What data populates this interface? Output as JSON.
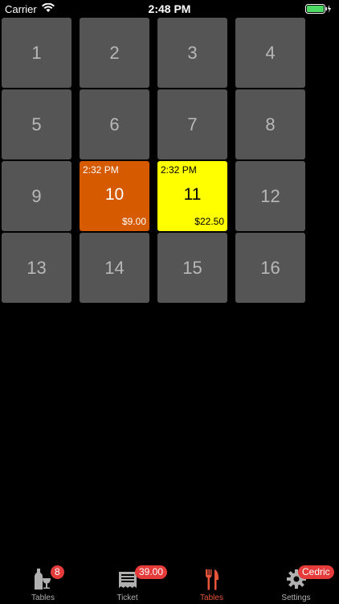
{
  "status_bar": {
    "carrier": "Carrier",
    "time": "2:48 PM"
  },
  "tables": [
    {
      "number": "1"
    },
    {
      "number": "2"
    },
    {
      "number": "3"
    },
    {
      "number": "4"
    },
    {
      "number": "5"
    },
    {
      "number": "6"
    },
    {
      "number": "7"
    },
    {
      "number": "8"
    },
    {
      "number": "9"
    },
    {
      "number": "10",
      "time": "2:32 PM",
      "amount": "$9.00",
      "color": "#d55a00"
    },
    {
      "number": "11",
      "time": "2:32 PM",
      "amount": "$22.50",
      "color": "#ffff00"
    },
    {
      "number": "12"
    },
    {
      "number": "13"
    },
    {
      "number": "14"
    },
    {
      "number": "15"
    },
    {
      "number": "16"
    }
  ],
  "tab_bar": {
    "tabs": [
      {
        "label": "Tables",
        "badge": "8",
        "icon": "wine-icon"
      },
      {
        "label": "Ticket",
        "badge": "39.00",
        "icon": "receipt-icon"
      },
      {
        "label": "Tables",
        "badge": "",
        "icon": "fork-knife-icon"
      },
      {
        "label": "Settings",
        "badge": "Cedric",
        "icon": "gear-icon"
      }
    ],
    "selected_index": 2,
    "accent": "#e8553a",
    "badge_color": "#e53b3b"
  }
}
